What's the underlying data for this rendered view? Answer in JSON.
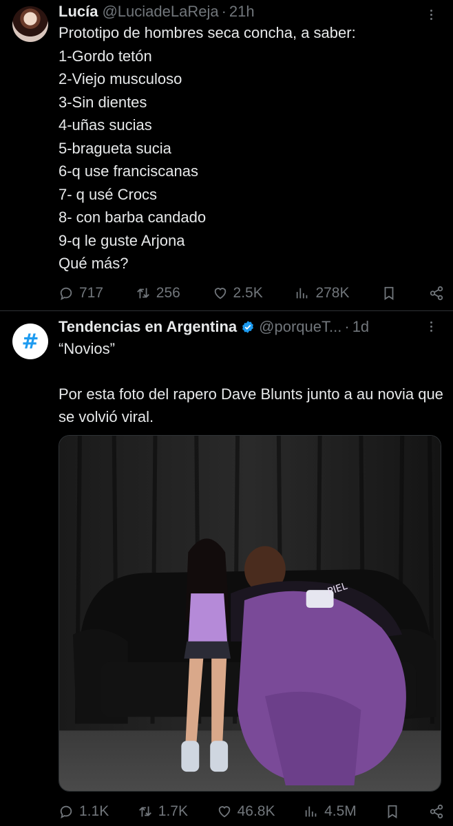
{
  "tweets": [
    {
      "name": "Lucía",
      "handle": "@LuciadeLaReja",
      "separator": "·",
      "time": "21h",
      "text": "Prototipo de hombres seca concha, a saber:\n1-Gordo tetón\n2-Viejo musculoso\n3-Sin dientes\n4-uñas sucias\n5-bragueta sucia\n6-q use franciscanas\n7- q usé Crocs\n8- con barba candado\n9-q le guste Arjona\nQué  más?",
      "replies": "717",
      "reposts": "256",
      "likes": "2.5K",
      "views": "278K"
    },
    {
      "name": "Tendencias en Argentina",
      "handle": "@porqueT...",
      "separator": "·",
      "time": "1d",
      "avatar_symbol": "#",
      "text": "“Novios”\n\nPor esta foto del rapero Dave Blunts junto a au novia que se volvió viral.",
      "replies": "1.1K",
      "reposts": "1.7K",
      "likes": "46.8K",
      "views": "4.5M"
    }
  ],
  "icons": [
    "reply-icon",
    "repost-icon",
    "like-icon",
    "views-icon",
    "bookmark-icon",
    "share-icon",
    "verified-icon",
    "more-icon"
  ],
  "colors": {
    "background": "#000000",
    "text": "#e7e9ea",
    "muted": "#71767b",
    "accent": "#1d9bf0",
    "divider": "#2f3336"
  }
}
